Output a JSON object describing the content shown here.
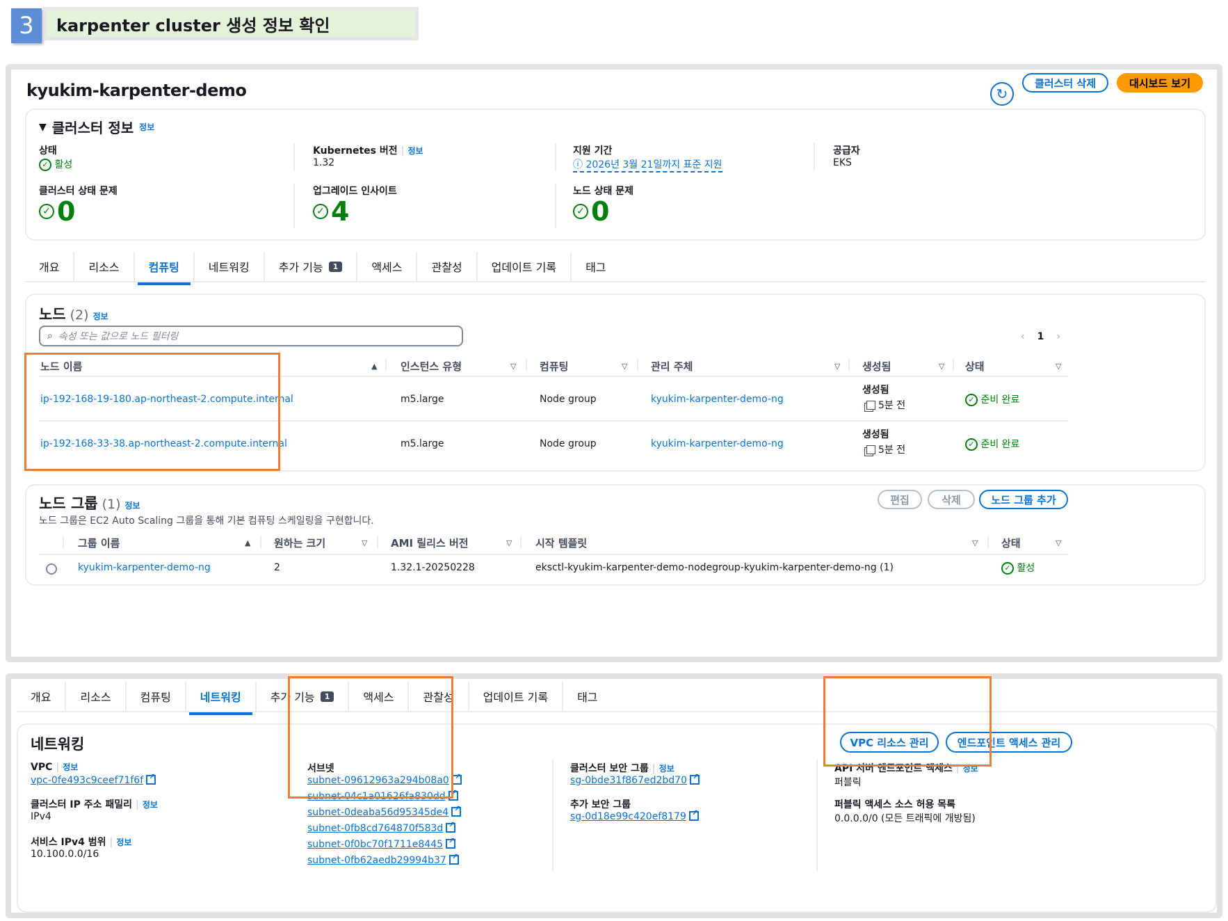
{
  "step": {
    "number": "3",
    "title": "karpenter cluster 생성 정보 확인"
  },
  "cluster": {
    "name": "kyukim-karpenter-demo",
    "buttons": {
      "delete": "클러스터 삭제",
      "dashboard": "대시보드 보기"
    },
    "info": {
      "heading": "클러스터 정보",
      "info_link": "정보",
      "status_label": "상태",
      "status_value": "활성",
      "k8s_label": "Kubernetes 버전",
      "k8s_value": "1.32",
      "support_label": "지원 기간",
      "support_value": "2026년 3월 21일까지 표준 지원",
      "provider_label": "공급자",
      "provider_value": "EKS",
      "health_label": "클러스터 상태 문제",
      "health_value": "0",
      "upgrade_label": "업그레이드 인사이트",
      "upgrade_value": "4",
      "node_health_label": "노드 상태 문제",
      "node_health_value": "0"
    }
  },
  "tabs1": {
    "overview": "개요",
    "resources": "리소스",
    "compute": "컴퓨팅",
    "networking": "네트워킹",
    "addons": "추가 기능",
    "addons_count": "1",
    "access": "액세스",
    "observability": "관찰성",
    "update_history": "업데이트 기록",
    "tags": "태그"
  },
  "nodes": {
    "title": "노드",
    "count": "(2)",
    "info_link": "정보",
    "search_placeholder": "속성 또는 값으로 노드 필터링",
    "page": "1",
    "columns": {
      "name": "노드 이름",
      "instance_type": "인스턴스 유형",
      "compute": "컴퓨팅",
      "managed_by": "관리 주체",
      "created": "생성됨",
      "status": "상태"
    },
    "rows": [
      {
        "name": "ip-192-168-19-180.ap-northeast-2.compute.internal",
        "instance_type": "m5.large",
        "compute": "Node group",
        "managed_by": "kyukim-karpenter-demo-ng",
        "created_label": "생성됨",
        "created_value": "5분 전",
        "status": "준비 완료"
      },
      {
        "name": "ip-192-168-33-38.ap-northeast-2.compute.internal",
        "instance_type": "m5.large",
        "compute": "Node group",
        "managed_by": "kyukim-karpenter-demo-ng",
        "created_label": "생성됨",
        "created_value": "5분 전",
        "status": "준비 완료"
      }
    ]
  },
  "nodegroups": {
    "title": "노드 그룹",
    "count": "(1)",
    "info_link": "정보",
    "description": "노드 그룹은 EC2 Auto Scaling 그룹을 통해 기본 컴퓨팅 스케일링을 구현합니다.",
    "buttons": {
      "edit": "편집",
      "delete": "삭제",
      "add": "노드 그룹 추가"
    },
    "columns": {
      "name": "그룹 이름",
      "desired": "원하는 크기",
      "ami": "AMI 릴리스 버전",
      "template": "시작 템플릿",
      "status": "상태"
    },
    "rows": [
      {
        "name": "kyukim-karpenter-demo-ng",
        "desired": "2",
        "ami": "1.32.1-20250228",
        "template": "eksctl-kyukim-karpenter-demo-nodegroup-kyukim-karpenter-demo-ng (1)",
        "status": "활성"
      }
    ]
  },
  "tabs2": {
    "overview": "개요",
    "resources": "리소스",
    "compute": "컴퓨팅",
    "networking": "네트워킹",
    "addons": "추가 기능",
    "addons_count": "1",
    "access": "액세스",
    "observability": "관찰성",
    "update_history": "업데이트 기록",
    "tags": "태그"
  },
  "networking": {
    "title": "네트워킹",
    "buttons": {
      "vpc": "VPC 리소스 관리",
      "endpoint": "엔드포인트 액세스 관리"
    },
    "info_link": "정보",
    "vpc_label": "VPC",
    "vpc_value": "vpc-0fe493c9ceef71f6f",
    "ip_family_label": "클러스터 IP 주소 패밀리",
    "ip_family_value": "IPv4",
    "service_range_label": "서비스 IPv4 범위",
    "service_range_value": "10.100.0.0/16",
    "subnets_label": "서브넷",
    "subnets": [
      "subnet-09612963a294b08a0",
      "subnet-04c1a01626fa830dd",
      "subnet-0deaba56d95345de4",
      "subnet-0fb8cd764870f583d",
      "subnet-0f0bc70f1711e8445",
      "subnet-0fb62aedb29994b37"
    ],
    "cluster_sg_label": "클러스터 보안 그룹",
    "cluster_sg_value": "sg-0bde31f867ed2bd70",
    "extra_sg_label": "추가 보안 그룹",
    "extra_sg_value": "sg-0d18e99c420ef8179",
    "endpoint_label": "API 서버 엔드포인트 액세스",
    "endpoint_value": "퍼블릭",
    "public_cidr_label": "퍼블릭 액세스 소스 허용 목록",
    "public_cidr_value": "0.0.0.0/0 (모든 트래픽에 개방됨)"
  }
}
